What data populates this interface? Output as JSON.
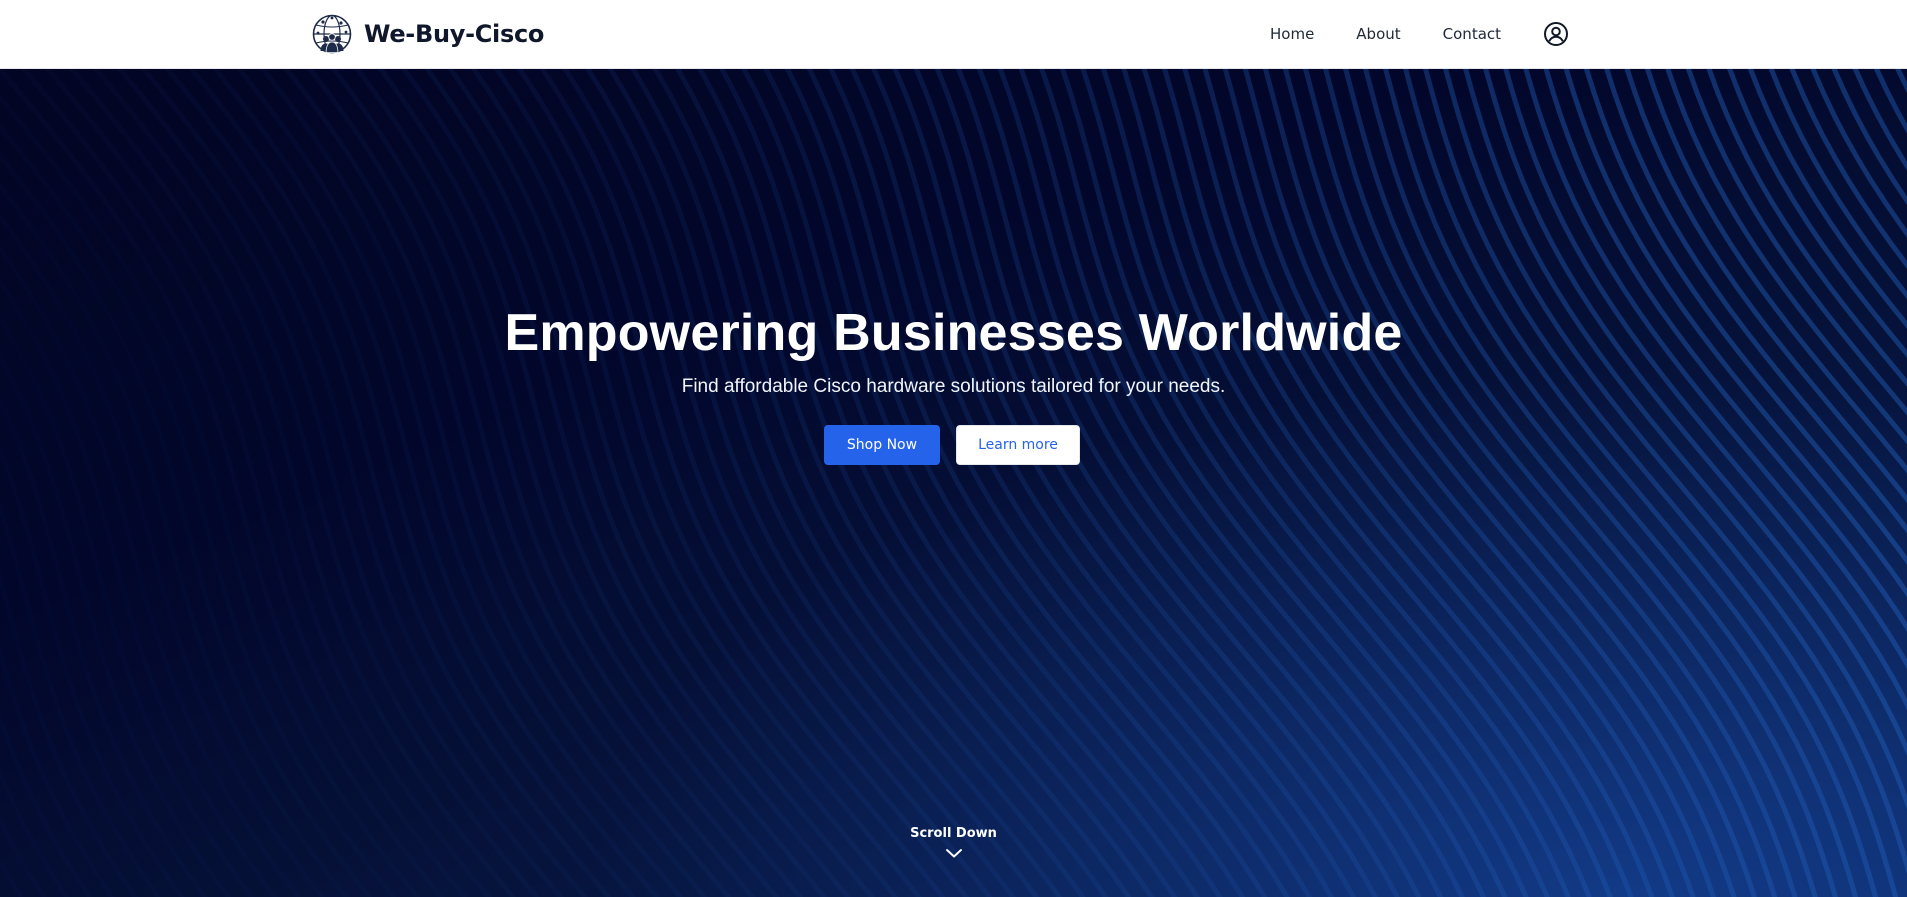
{
  "header": {
    "brand_name": "We-Buy-Cisco",
    "nav": [
      {
        "label": "Home"
      },
      {
        "label": "About"
      },
      {
        "label": "Contact"
      }
    ],
    "account_icon": "user-circle-icon",
    "logo_icon": "globe-people-icon"
  },
  "hero": {
    "title": "Empowering Businesses Worldwide",
    "subtitle": "Find affordable Cisco hardware solutions tailored for your needs.",
    "primary_button": "Shop Now",
    "secondary_button": "Learn more",
    "scroll_label": "Scroll Down",
    "scroll_icon": "chevron-down-icon"
  },
  "colors": {
    "brand_text": "#0f172a",
    "primary": "#2563eb",
    "hero_bg": "#030524",
    "hero_accent": "#1e5ac8"
  }
}
